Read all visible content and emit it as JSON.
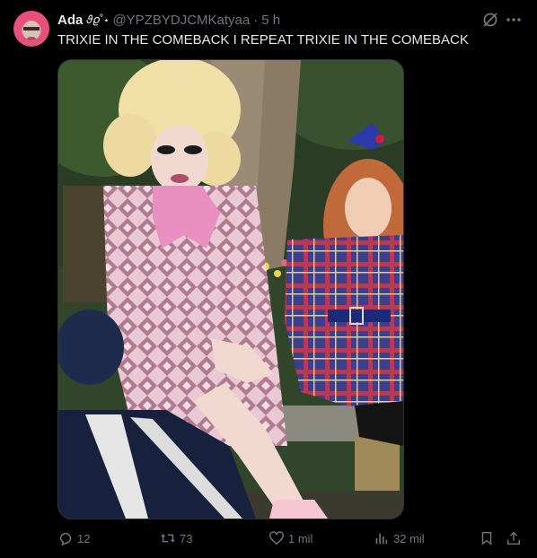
{
  "tweet": {
    "author_name": "Ada",
    "author_deco": "𝜗𝜚˚⋆",
    "handle": "@YPZBYDJCMKatyaa",
    "separator": "·",
    "time": "5 h",
    "text": "TRIXIE IN THE COMEBACK I REPEAT TRIXIE IN THE COMEBACK"
  },
  "actions": {
    "replies": "12",
    "reposts": "73",
    "likes": "1 mil",
    "views": "32 mil"
  },
  "icons": [
    "grok-icon",
    "more-icon",
    "reply-icon",
    "repost-icon",
    "like-icon",
    "views-icon",
    "bookmark-icon",
    "share-icon"
  ],
  "colors": {
    "background": "#000000",
    "text": "#e7e9ea",
    "secondary": "#71767b"
  }
}
